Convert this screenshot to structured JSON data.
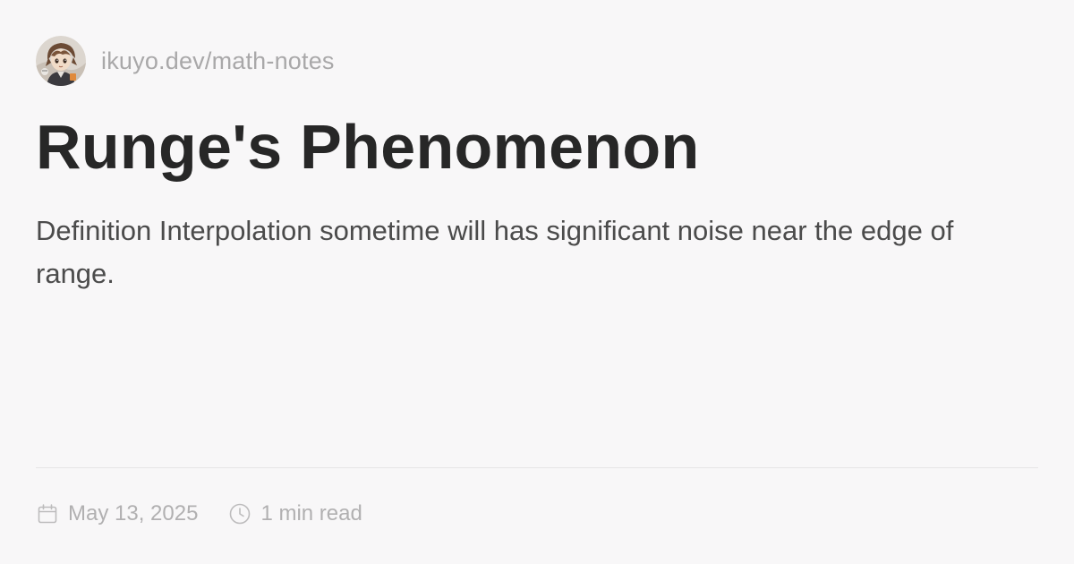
{
  "site": {
    "url": "ikuyo.dev/math-notes",
    "avatar_icon": "anime-character-avatar-icon"
  },
  "post": {
    "title": "Runge's Phenomenon",
    "description": "Definition Interpolation sometime will has significant noise near the edge of range."
  },
  "meta": {
    "date_icon": "calendar-icon",
    "date": "May 13, 2025",
    "reading_icon": "clock-icon",
    "reading_time": "1 min read"
  },
  "colors": {
    "background": "#f8f7f8",
    "title": "#272727",
    "description": "#4b4b4b",
    "muted": "#a9a8a9",
    "divider": "#e6e4e6"
  }
}
